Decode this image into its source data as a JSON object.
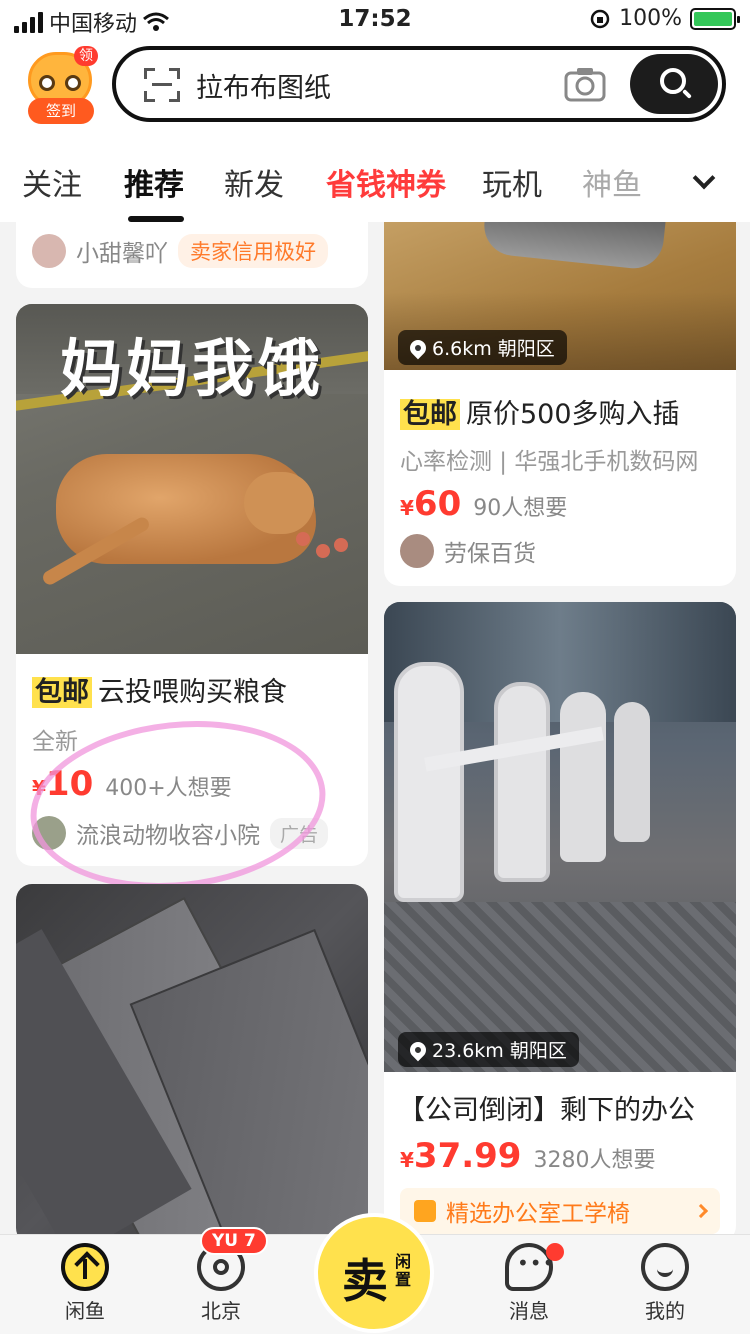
{
  "status_bar": {
    "carrier": "中国移动",
    "time": "17:52",
    "battery": "100%"
  },
  "header": {
    "signin_tag": "领",
    "signin_label": "签到",
    "search_text": "拉布布图纸",
    "tabs": [
      "关注",
      "推荐",
      "新发",
      "省钱神券",
      "玩机",
      "神鱼"
    ]
  },
  "feed": {
    "card_top_left": {
      "seller": "小甜馨吖",
      "badge": "卖家信用极好"
    },
    "card_cat": {
      "overlay_text": "妈妈我饿",
      "tag": "包邮",
      "title": "云投喂购买粮食",
      "condition": "全新",
      "currency": "¥",
      "price": "10",
      "wants": "400+人想要",
      "seller": "流浪动物收容小院",
      "ad": "广告"
    },
    "card_watch": {
      "location": "6.6km 朝阳区",
      "tag": "包邮",
      "title": "原价500多购入插",
      "desc": "心率检测 | 华强北手机数码网",
      "currency": "¥",
      "price": "60",
      "wants": "90人想要",
      "seller": "劳保百货"
    },
    "card_chairs": {
      "location": "23.6km 朝阳区",
      "title": "【公司倒闭】剩下的办公",
      "currency": "¥",
      "price": "37.99",
      "wants": "3280人想要",
      "promo": "精选办公室工学椅"
    }
  },
  "bottom_nav": {
    "home": "闲鱼",
    "city": "北京",
    "city_badge": "YU 7",
    "sell_big": "卖",
    "sell_small": "闲置",
    "messages": "消息",
    "me": "我的"
  }
}
